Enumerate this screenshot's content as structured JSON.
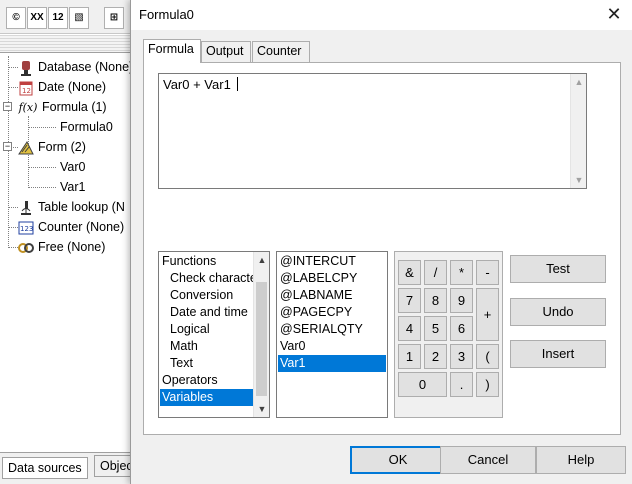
{
  "background_app": {
    "toolbar": [
      "©",
      "XX",
      "12",
      "▧",
      "⊞"
    ],
    "tree": [
      {
        "label": "Database (None)",
        "icon": "database-icon"
      },
      {
        "label": "Date (None)",
        "icon": "calendar-icon"
      },
      {
        "label": "Formula (1)",
        "icon": "function-icon"
      },
      {
        "label": "Formula0",
        "icon": ""
      },
      {
        "label": "Form (2)",
        "icon": "form-icon"
      },
      {
        "label": "Var0",
        "icon": ""
      },
      {
        "label": "Var1",
        "icon": ""
      },
      {
        "label": "Table lookup (N",
        "icon": "microscope-icon"
      },
      {
        "label": "Counter (None)",
        "icon": "counter-icon"
      },
      {
        "label": "Free (None)",
        "icon": "link-icon"
      }
    ],
    "bottom_tabs": [
      "Data sources",
      "Objec"
    ]
  },
  "dialog": {
    "title": "Formula0",
    "close_glyph": "✕",
    "tabs": [
      "Formula",
      "Output",
      "Counter"
    ],
    "formula_text": "Var0 + Var1",
    "categories": [
      {
        "label": "Functions",
        "indent": false
      },
      {
        "label": "Check characte",
        "indent": true
      },
      {
        "label": "Conversion",
        "indent": true
      },
      {
        "label": "Date and time",
        "indent": true
      },
      {
        "label": "Logical",
        "indent": true
      },
      {
        "label": "Math",
        "indent": true
      },
      {
        "label": "Text",
        "indent": true
      },
      {
        "label": "Operators",
        "indent": false
      },
      {
        "label": "Variables",
        "indent": false,
        "selected": true
      }
    ],
    "variables": [
      {
        "label": "@INTERCUT"
      },
      {
        "label": "@LABELCPY"
      },
      {
        "label": "@LABNAME"
      },
      {
        "label": "@PAGECPY"
      },
      {
        "label": "@SERIALQTY"
      },
      {
        "label": "Var0"
      },
      {
        "label": "Var1",
        "selected": true
      }
    ],
    "keypad": {
      "amp": "&",
      "slash": "/",
      "star": "*",
      "minus": "-",
      "k7": "7",
      "k8": "8",
      "k9": "9",
      "plus": "+",
      "k4": "4",
      "k5": "5",
      "k6": "6",
      "k1": "1",
      "k2": "2",
      "k3": "3",
      "lparen": "(",
      "k0": "0",
      "dot": ".",
      "rparen": ")"
    },
    "side_buttons": {
      "test": "Test",
      "undo": "Undo",
      "insert": "Insert"
    },
    "footer": {
      "ok": "OK",
      "cancel": "Cancel",
      "help": "Help"
    },
    "colors": {
      "selection": "#0078d7",
      "dialog_bg": "#f0f0f0"
    }
  }
}
